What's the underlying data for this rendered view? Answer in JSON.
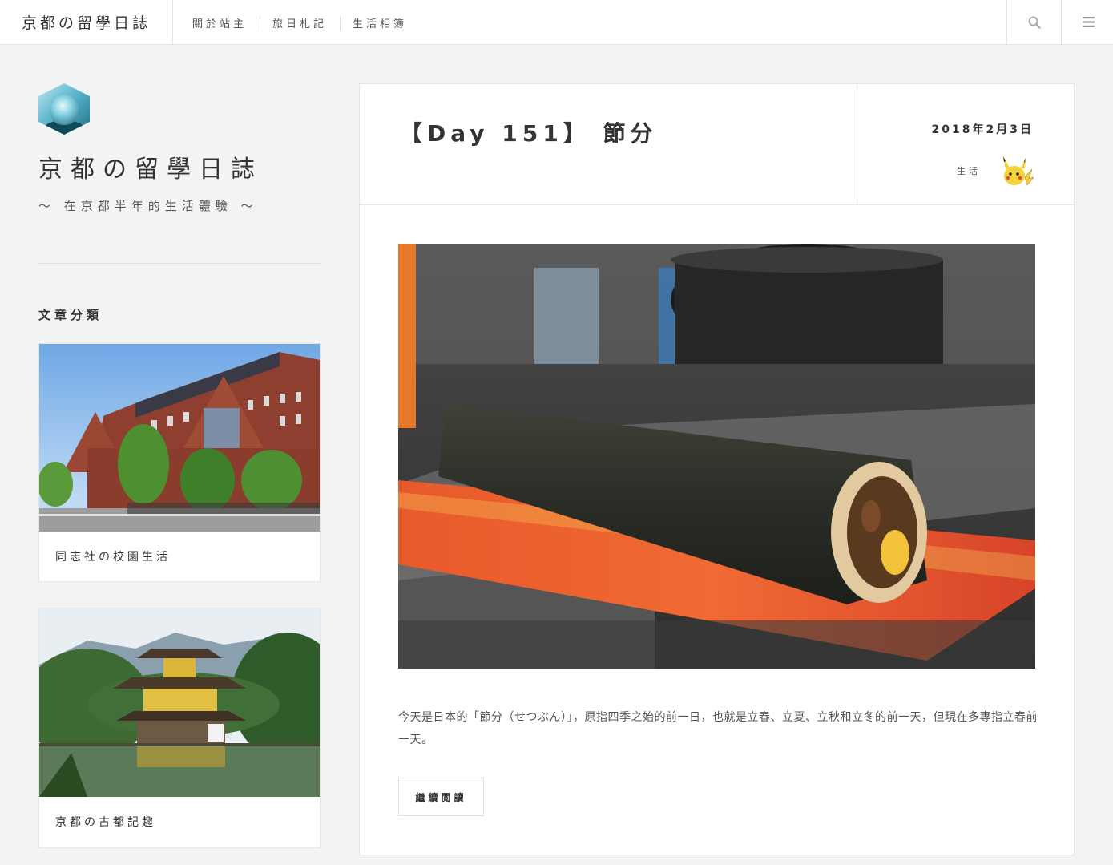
{
  "header": {
    "brand": "京都の留學日誌",
    "nav": [
      "關於站主",
      "旅日札記",
      "生活相簿"
    ],
    "search_icon": "search-icon",
    "menu_icon": "hamburger-menu-icon"
  },
  "sidebar": {
    "title": "京都の留學日誌",
    "tagline": "～ 在京都半年的生活體驗 ～",
    "categories_heading": "文章分類",
    "categories": [
      {
        "label": "同志社の校園生活"
      },
      {
        "label": "京都の古都記趣"
      }
    ]
  },
  "post": {
    "title": "【Day 151】 節分",
    "date": "2018年2月3日",
    "category": "生活",
    "excerpt": "今天是日本的「節分（せつぶん）」，原指四季之始的前一日，也就是立春、立夏、立秋和立冬的前一天，但現在多專指立春前一天。",
    "read_more": "繼續閱讀"
  },
  "colors": {
    "page_bg": "#f3f3f3",
    "card_bg": "#ffffff",
    "text": "#333333",
    "border": "#e4e4e4"
  }
}
